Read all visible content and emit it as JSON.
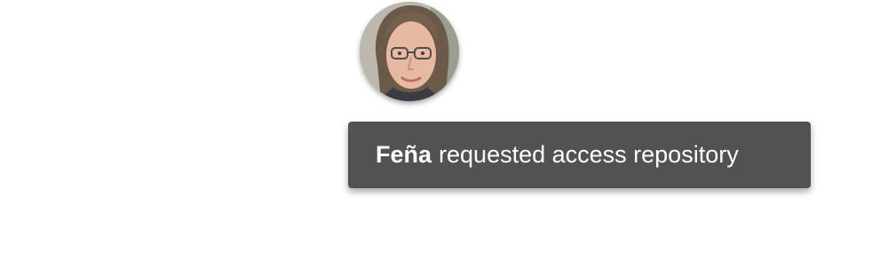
{
  "notification": {
    "user_name": "Feña",
    "message": "requested access repository",
    "background_color": "#525252",
    "text_color": "#ffffff"
  },
  "avatar": {
    "icon": "user-avatar-photo"
  }
}
